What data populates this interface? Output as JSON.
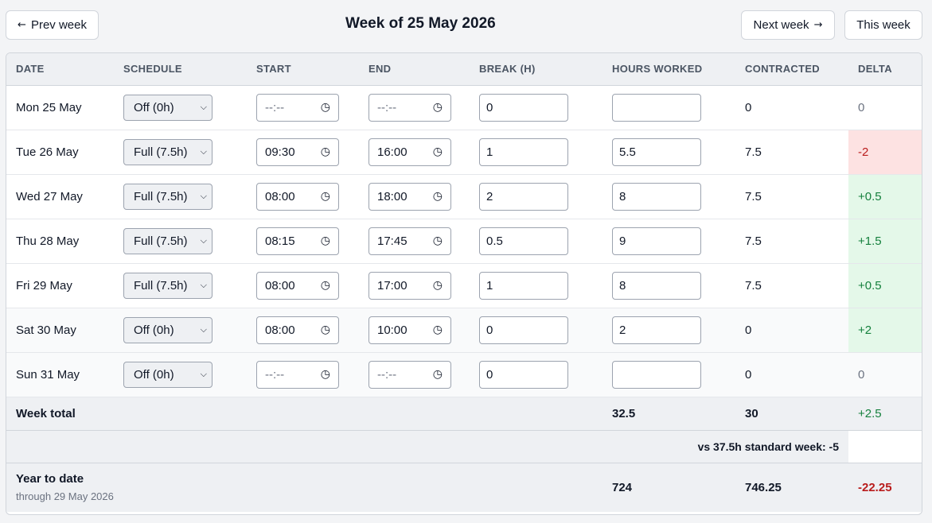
{
  "nav": {
    "prev_label": "Prev week",
    "next_label": "Next week",
    "this_label": "This week",
    "prev_arrow": "←",
    "next_arrow": "→",
    "title": "Week of 25 May 2026"
  },
  "headers": {
    "date": "DATE",
    "schedule": "SCHEDULE",
    "start": "START",
    "end": "END",
    "break": "BREAK (H)",
    "hours": "HOURS WORKED",
    "contracted": "CONTRACTED",
    "delta": "DELTA"
  },
  "time_placeholder": "--:--",
  "days": [
    {
      "date": "Mon 25 May",
      "schedule": "Off (0h)",
      "start": "--:--",
      "end": "--:--",
      "break": "0",
      "hours": "",
      "contracted": "0",
      "delta": "0",
      "delta_state": "neutral"
    },
    {
      "date": "Tue 26 May",
      "schedule": "Full (7.5h)",
      "start": "09:30",
      "end": "16:00",
      "break": "1",
      "hours": "5.5",
      "contracted": "7.5",
      "delta": "-2",
      "delta_state": "negative"
    },
    {
      "date": "Wed 27 May",
      "schedule": "Full (7.5h)",
      "start": "08:00",
      "end": "18:00",
      "break": "2",
      "hours": "8",
      "contracted": "7.5",
      "delta": "+0.5",
      "delta_state": "positive"
    },
    {
      "date": "Thu 28 May",
      "schedule": "Full (7.5h)",
      "start": "08:15",
      "end": "17:45",
      "break": "0.5",
      "hours": "9",
      "contracted": "7.5",
      "delta": "+1.5",
      "delta_state": "positive"
    },
    {
      "date": "Fri 29 May",
      "schedule": "Full (7.5h)",
      "start": "08:00",
      "end": "17:00",
      "break": "1",
      "hours": "8",
      "contracted": "7.5",
      "delta": "+0.5",
      "delta_state": "positive"
    },
    {
      "date": "Sat 30 May",
      "schedule": "Off (0h)",
      "start": "08:00",
      "end": "10:00",
      "break": "0",
      "hours": "2",
      "contracted": "0",
      "delta": "+2",
      "delta_state": "positive"
    },
    {
      "date": "Sun 31 May",
      "schedule": "Off (0h)",
      "start": "--:--",
      "end": "--:--",
      "break": "0",
      "hours": "",
      "contracted": "0",
      "delta": "0",
      "delta_state": "neutral"
    }
  ],
  "week_total": {
    "label": "Week total",
    "hours": "32.5",
    "contracted": "30",
    "delta": "+2.5",
    "vs_standard": "vs 37.5h standard week: -5"
  },
  "ytd": {
    "label": "Year to date",
    "sub": "through 29 May 2026",
    "hours": "724",
    "contracted": "746.25",
    "delta": "-22.25"
  },
  "colors": {
    "positive_text": "#15803d",
    "positive_bg": "#e4f8e9",
    "negative_text": "#b91c1c",
    "negative_bg": "#fde2e2"
  },
  "icons": {
    "select_chevron": "chevron-down-icon",
    "time_clock": "clock-icon",
    "prev_arrow": "arrow-left-icon",
    "next_arrow": "arrow-right-icon"
  }
}
